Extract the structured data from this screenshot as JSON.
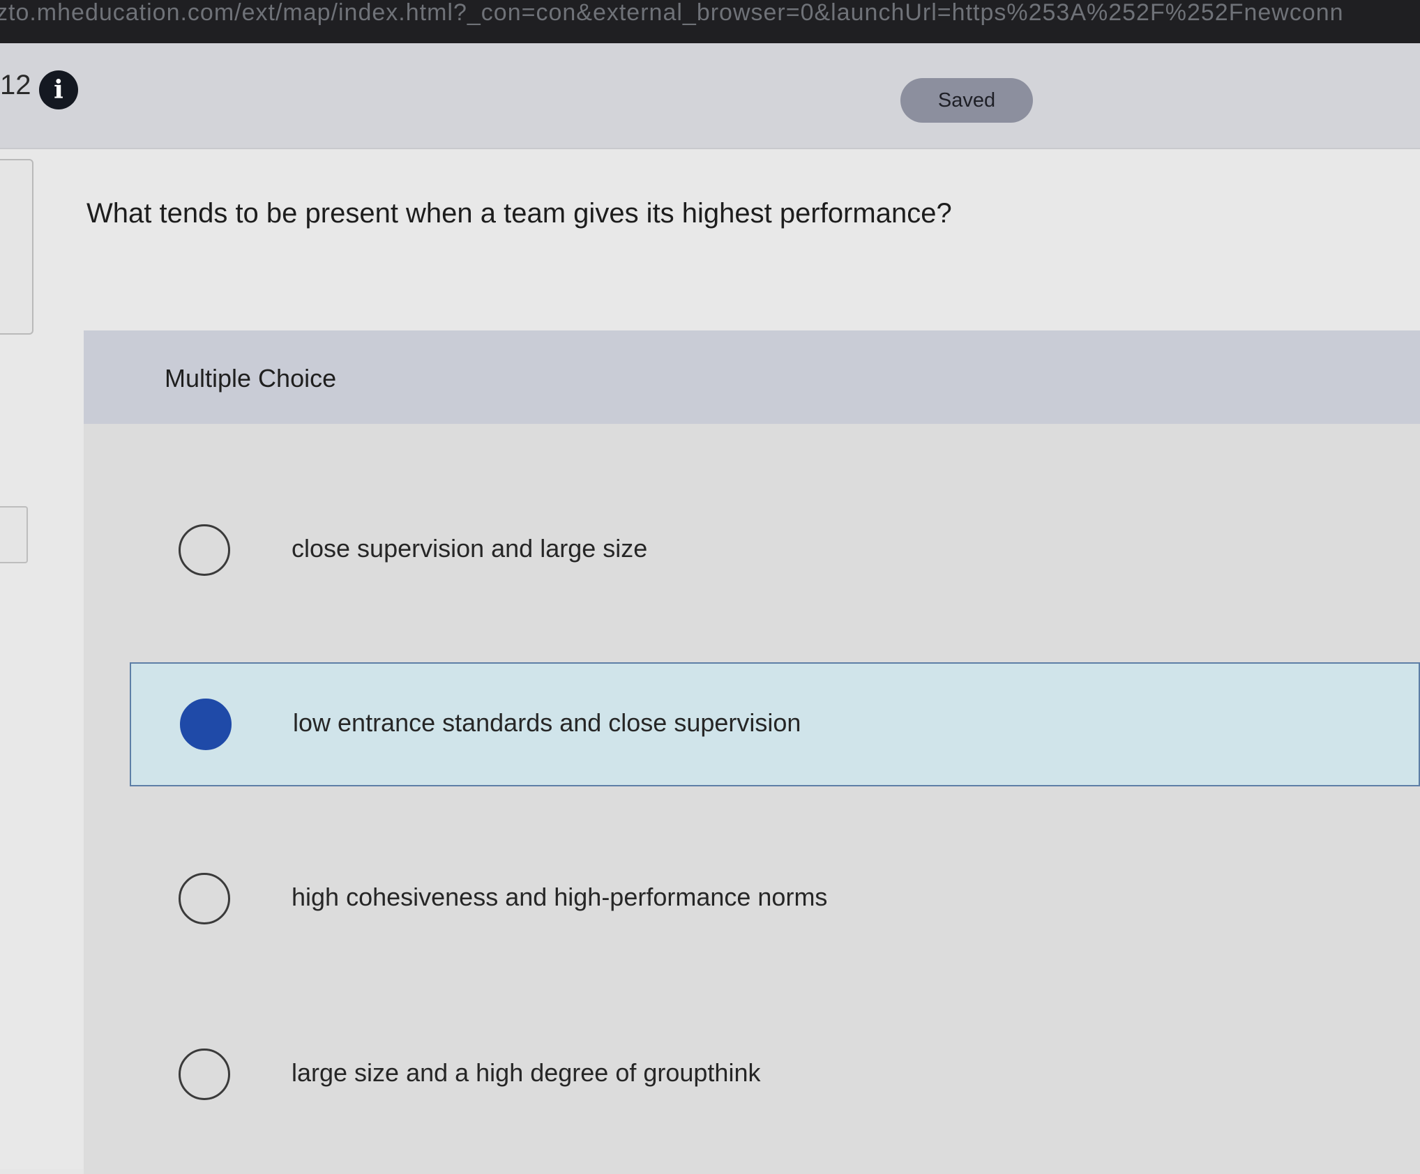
{
  "browser": {
    "url": "zto.mheducation.com/ext/map/index.html?_con=con&external_browser=0&launchUrl=https%253A%252F%252Fnewconn"
  },
  "header": {
    "question_number": "12",
    "info_icon": "info-icon",
    "status": "Saved"
  },
  "question": {
    "text": "What tends to be present when a team gives its highest performance?"
  },
  "answer_panel": {
    "type_label": "Multiple Choice",
    "choices": [
      {
        "label": "close supervision and large size",
        "selected": false
      },
      {
        "label": "low entrance standards and close supervision",
        "selected": true
      },
      {
        "label": "high cohesiveness and high-performance norms",
        "selected": false
      },
      {
        "label": "large size and a high degree of groupthink",
        "selected": false
      }
    ]
  },
  "colors": {
    "accent": "#1f4aa8",
    "selected_background": "#d0e4ea",
    "selected_border": "#5d7ea6"
  }
}
